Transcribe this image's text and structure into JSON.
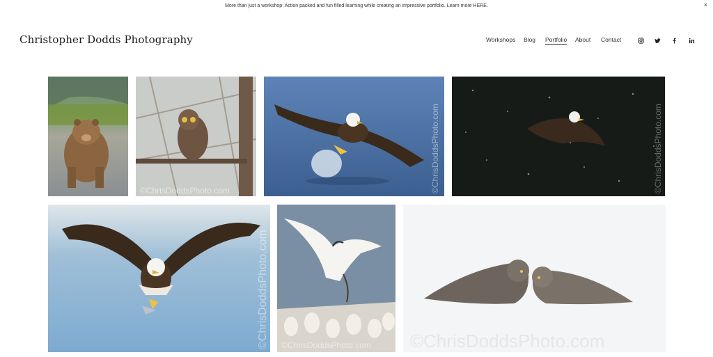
{
  "announcement": {
    "text": "More than just a workshop: Action packed and fun filled learning while creating an impressive portfolio. Learn more HERE.",
    "close_label": "×"
  },
  "site": {
    "title": "Christopher Dodds Photography"
  },
  "nav": {
    "items": [
      {
        "label": "Workshops",
        "active": false
      },
      {
        "label": "Blog",
        "active": false
      },
      {
        "label": "Portfolio",
        "active": true
      },
      {
        "label": "About",
        "active": false
      },
      {
        "label": "Contact",
        "active": false
      }
    ],
    "social": [
      "instagram-icon",
      "twitter-icon",
      "facebook-icon",
      "linkedin-icon"
    ]
  },
  "gallery": {
    "watermark": "©ChrisDoddsPhoto.com",
    "photos": [
      {
        "subject": "bear cub"
      },
      {
        "subject": "owl on branch"
      },
      {
        "subject": "eagle fishing"
      },
      {
        "subject": "eagle in snowfall"
      },
      {
        "subject": "eagle with fish"
      },
      {
        "subject": "gannets"
      },
      {
        "subject": "great grey owls"
      }
    ]
  },
  "colors": {
    "text": "#333333",
    "background": "#ffffff"
  }
}
